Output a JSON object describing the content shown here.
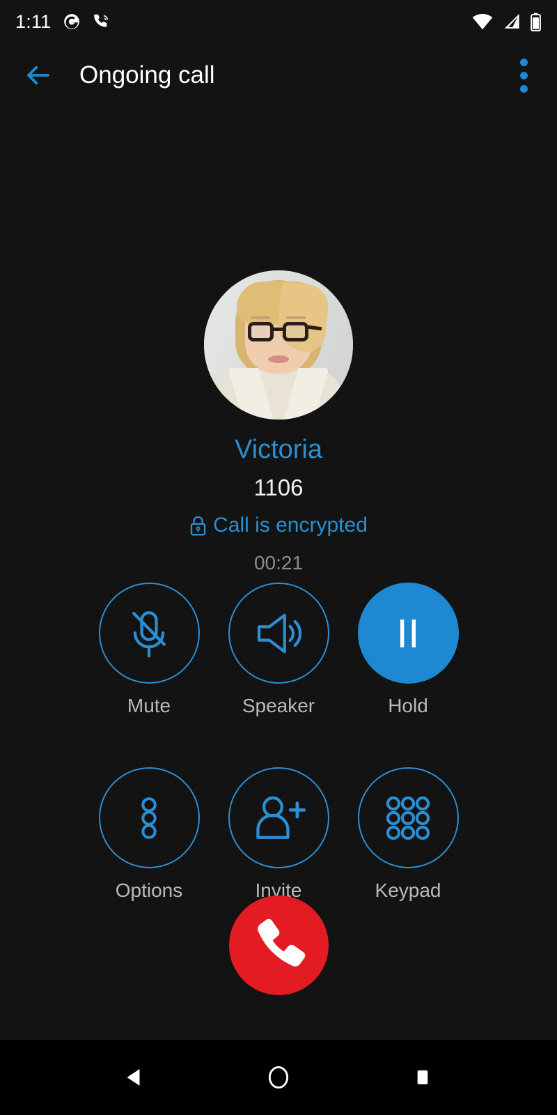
{
  "status_bar": {
    "clock": "1:11",
    "left_icons": [
      {
        "name": "google-app-icon",
        "glyph": "G"
      },
      {
        "name": "call-in-progress-icon",
        "glyph": "phone-waves"
      }
    ],
    "right_icons": [
      {
        "name": "wifi-icon",
        "glyph": "wifi-full"
      },
      {
        "name": "cellular-signal-icon",
        "glyph": "signal-partial"
      },
      {
        "name": "battery-icon",
        "glyph": "battery"
      }
    ]
  },
  "app_bar": {
    "back_label": "back-arrow",
    "title": "Ongoing call",
    "overflow_label": "more-options"
  },
  "contact": {
    "avatar_alt": "Victoria profile photo",
    "name": "Victoria",
    "number": "1106",
    "encryption_text": "Call is encrypted",
    "timer": "00:21"
  },
  "controls": {
    "rows": [
      [
        {
          "id": "mute",
          "label": "Mute",
          "icon": "microphone-off-icon",
          "active": false
        },
        {
          "id": "speaker",
          "label": "Speaker",
          "icon": "speaker-icon",
          "active": false
        },
        {
          "id": "hold",
          "label": "Hold",
          "icon": "pause-icon",
          "active": true
        }
      ],
      [
        {
          "id": "options",
          "label": "Options",
          "icon": "dots-vertical-icon",
          "active": false
        },
        {
          "id": "invite",
          "label": "Invite",
          "icon": "person-add-icon",
          "active": false
        },
        {
          "id": "keypad",
          "label": "Keypad",
          "icon": "dialpad-icon",
          "active": false
        }
      ]
    ]
  },
  "end_call": {
    "label": "End call",
    "icon": "phone-handset-icon"
  },
  "nav_bar": {
    "back": "Back",
    "home": "Home",
    "recents": "Recent apps"
  },
  "colors": {
    "background": "#131313",
    "accent_blue": "#2b8fd4",
    "active_blue": "#1e88d2",
    "end_call_red": "#e31b23",
    "label_gray": "#b9b9b9",
    "timer_gray": "#8d8d8d",
    "nav_black": "#000000"
  }
}
